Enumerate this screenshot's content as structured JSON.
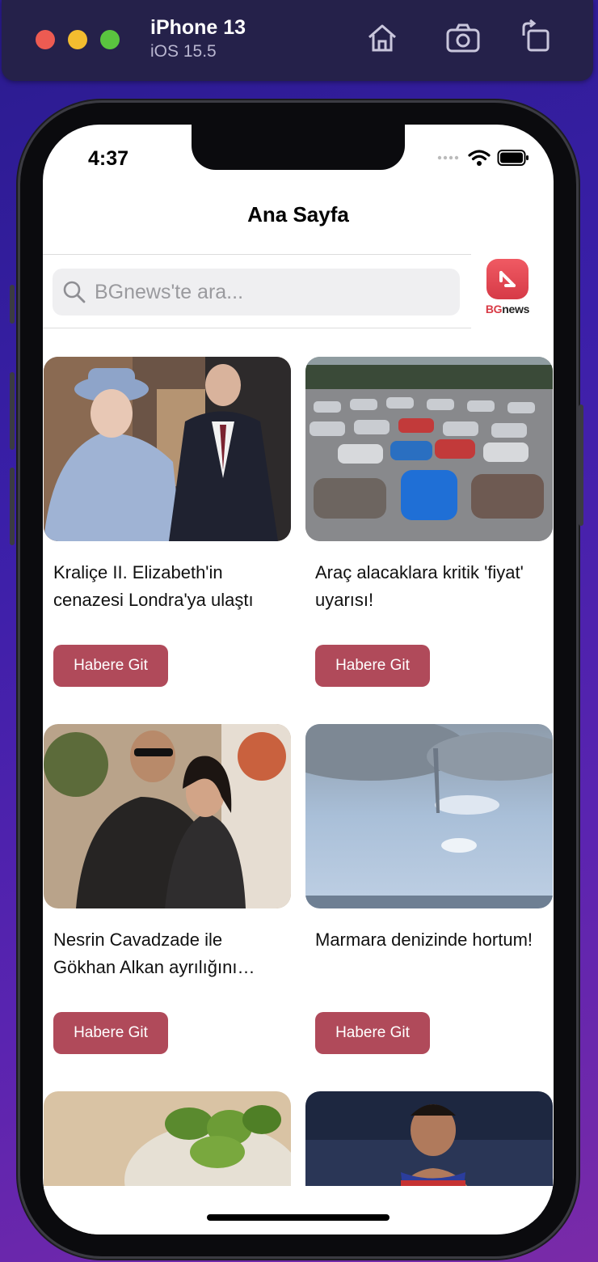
{
  "simulator": {
    "device_name": "iPhone 13",
    "os_version": "iOS 15.5"
  },
  "status_bar": {
    "time": "4:37"
  },
  "nav": {
    "title": "Ana Sayfa"
  },
  "search": {
    "placeholder": "BGnews'te ara..."
  },
  "logo": {
    "brand_part1": "BG",
    "brand_part2": "news"
  },
  "news": [
    {
      "title": "Kraliçe II. Elizabeth'in cenazesi Londra'ya ulaştı",
      "button_label": "Habere Git",
      "image": "royal-couple-photo"
    },
    {
      "title": "Araç alacaklara kritik 'fiyat' uyarısı!",
      "button_label": "Habere Git",
      "image": "parked-cars-photo"
    },
    {
      "title": "Nesrin Cavadzade ile Gökhan Alkan ayrılığını açıkladı",
      "button_label": "Habere Git",
      "image": "couple-hug-photo"
    },
    {
      "title": "Marmara denizinde hortum!",
      "button_label": "Habere Git",
      "image": "waterspout-photo"
    },
    {
      "title": "",
      "button_label": "",
      "image": "mint-tea-photo"
    },
    {
      "title": "",
      "button_label": "",
      "image": "wrestler-photo"
    }
  ],
  "colors": {
    "accent_button": "#b04a5a",
    "brand_red": "#d83a45"
  }
}
